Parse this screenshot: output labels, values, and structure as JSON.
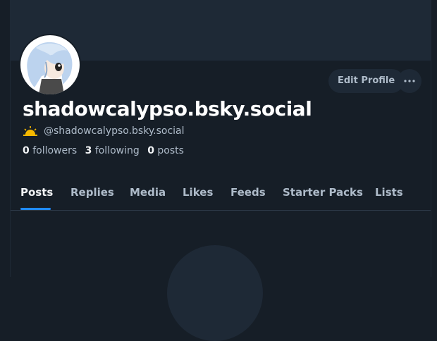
{
  "profile": {
    "display_name": "shadowcalypso.bsky.social",
    "handle": "@shadowcalypso.bsky.social",
    "status_icon": "sunrise-icon"
  },
  "actions": {
    "edit_label": "Edit Profile",
    "more_icon": "ellipsis-icon"
  },
  "stats": {
    "followers_count": "0",
    "followers_label": "followers",
    "following_count": "3",
    "following_label": "following",
    "posts_count": "0",
    "posts_label": "posts"
  },
  "tabs": [
    {
      "label": "Posts",
      "active": true
    },
    {
      "label": "Replies"
    },
    {
      "label": "Media"
    },
    {
      "label": "Likes"
    },
    {
      "label": "Feeds"
    },
    {
      "label": "Starter Packs"
    },
    {
      "label": "Lists"
    }
  ],
  "colors": {
    "background": "#161e27",
    "surface": "#1e2936",
    "accent": "#208bfe",
    "muted_text": "#aebbc9"
  }
}
